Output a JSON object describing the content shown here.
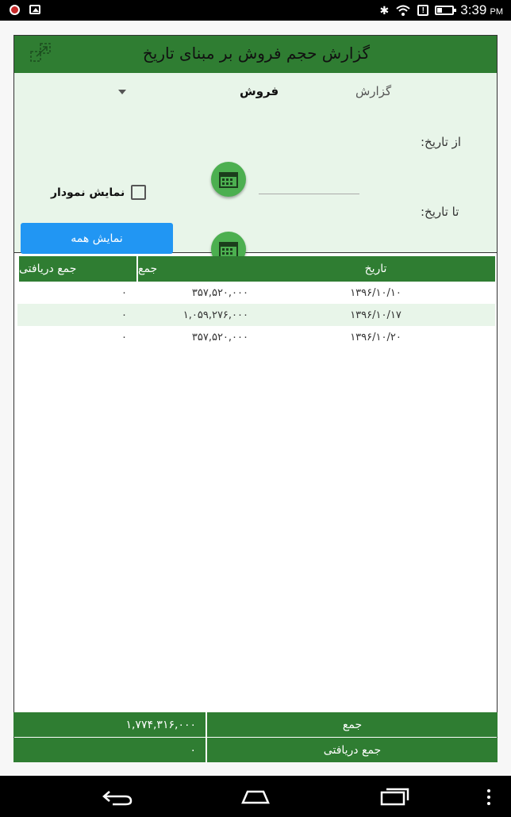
{
  "status_bar": {
    "time": "3:39",
    "ampm": "PM",
    "icons": [
      "notification-app-icon",
      "image-icon",
      "bluetooth-icon",
      "wifi-icon",
      "alert-icon",
      "battery-icon"
    ]
  },
  "header": {
    "title": "گزارش حجم فروش بر مبنای تاریخ"
  },
  "filter": {
    "report_label": "گزارش",
    "report_type_value": "فروش",
    "from_label": "از تاریخ:",
    "to_label": "تا تاریخ:",
    "from_value": "",
    "to_value": "",
    "show_chart_label": "نمایش نمودار",
    "show_chart_checked": false,
    "show_all_label": "نمایش همه"
  },
  "table": {
    "headers": {
      "date": "تاریخ",
      "sum": "جمع",
      "received": "جمع دریافتی"
    },
    "rows": [
      {
        "date": "۱۳۹۶/۱۰/۱۰",
        "sum": "۳۵۷,۵۲۰,۰۰۰",
        "received": "۰"
      },
      {
        "date": "۱۳۹۶/۱۰/۱۷",
        "sum": "۱,۰۵۹,۲۷۶,۰۰۰",
        "received": "۰"
      },
      {
        "date": "۱۳۹۶/۱۰/۲۰",
        "sum": "۳۵۷,۵۲۰,۰۰۰",
        "received": "۰"
      }
    ]
  },
  "totals": {
    "sum_label": "جمع",
    "sum_value": "۱,۷۷۴,۳۱۶,۰۰۰",
    "received_label": "جمع دریافتی",
    "received_value": "۰"
  },
  "colors": {
    "primary_green": "#2f7d32",
    "light_green": "#e8f5e9",
    "button_blue": "#2196f3",
    "fab_green": "#4caf50"
  }
}
